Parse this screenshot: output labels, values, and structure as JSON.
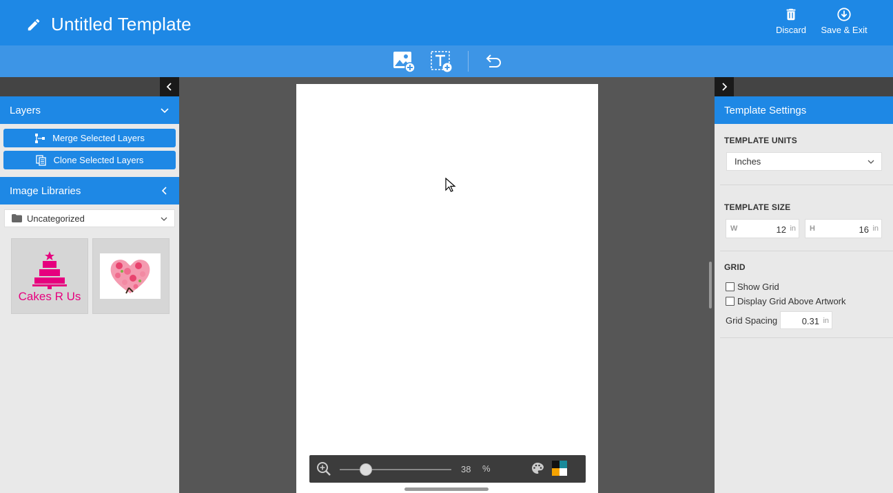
{
  "header": {
    "title": "Untitled Template",
    "discard_label": "Discard",
    "save_label": "Save & Exit",
    "icons": [
      "pencil-icon",
      "trash-icon",
      "download-circle-icon"
    ]
  },
  "toolbar": {
    "icons": [
      "add-image-icon",
      "add-text-icon",
      "undo-icon"
    ]
  },
  "left_panel": {
    "layers_title": "Layers",
    "merge_label": "Merge Selected Layers",
    "clone_label": "Clone Selected Layers",
    "image_libraries_title": "Image Libraries",
    "library_selected": "Uncategorized",
    "thumbnails": [
      {
        "caption": "Cakes R Us"
      },
      {
        "caption": ""
      }
    ]
  },
  "canvas": {
    "zoom_value": "38",
    "zoom_unit": "%",
    "zoom_level": 0.2
  },
  "right_panel": {
    "title": "Template Settings",
    "units_label": "TEMPLATE UNITS",
    "units_value": "Inches",
    "size_label": "TEMPLATE SIZE",
    "width_label": "W",
    "width_value": "12",
    "height_label": "H",
    "height_value": "16",
    "unit_suffix": "in",
    "grid_label": "GRID",
    "show_grid_label": "Show Grid",
    "grid_above_label": "Display Grid Above Artwork",
    "spacing_label": "Grid Spacing",
    "spacing_value": "0.31"
  },
  "colors": {
    "brand_blue": "#1e88e5",
    "toolbar_blue": "#3d95e6",
    "cake_pink": "#e6007e"
  }
}
